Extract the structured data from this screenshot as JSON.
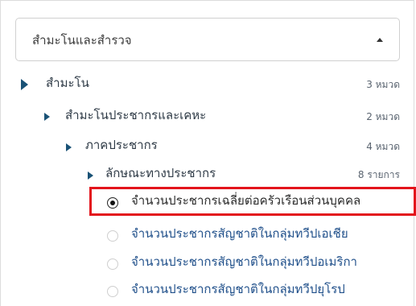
{
  "dropdown": {
    "label": "สำมะโนและสำรวจ",
    "toggle_icon": "caret-up-icon"
  },
  "tree": {
    "level1": {
      "label": "สำมะโน",
      "count": "3 หมวด"
    },
    "level2": {
      "label": "สำมะโนประชากรและเคหะ",
      "count": "2 หมวด"
    },
    "level3": {
      "label": "ภาคประชากร",
      "count": "4 หมวด"
    },
    "level4": {
      "label": "ลักษณะทางประชากร",
      "count": "8 รายการ"
    }
  },
  "options": [
    {
      "label": "จำนวนประชากรเฉลี่ยต่อครัวเรือนส่วนบุคคล",
      "selected": true
    },
    {
      "label": "จำนวนประชากรสัญชาติในกลุ่มทวีปเอเชีย",
      "selected": false
    },
    {
      "label": "จำนวนประชากรสัญชาติในกลุ่มทวีปอเมริกา",
      "selected": false
    },
    {
      "label": "จำนวนประชากรสัญชาติในกลุ่มทวีปยุโรป",
      "selected": false
    }
  ],
  "colors": {
    "tree_arrow": "#1a5276",
    "option_text": "#1f4f8a",
    "highlight": "#e3141c"
  }
}
